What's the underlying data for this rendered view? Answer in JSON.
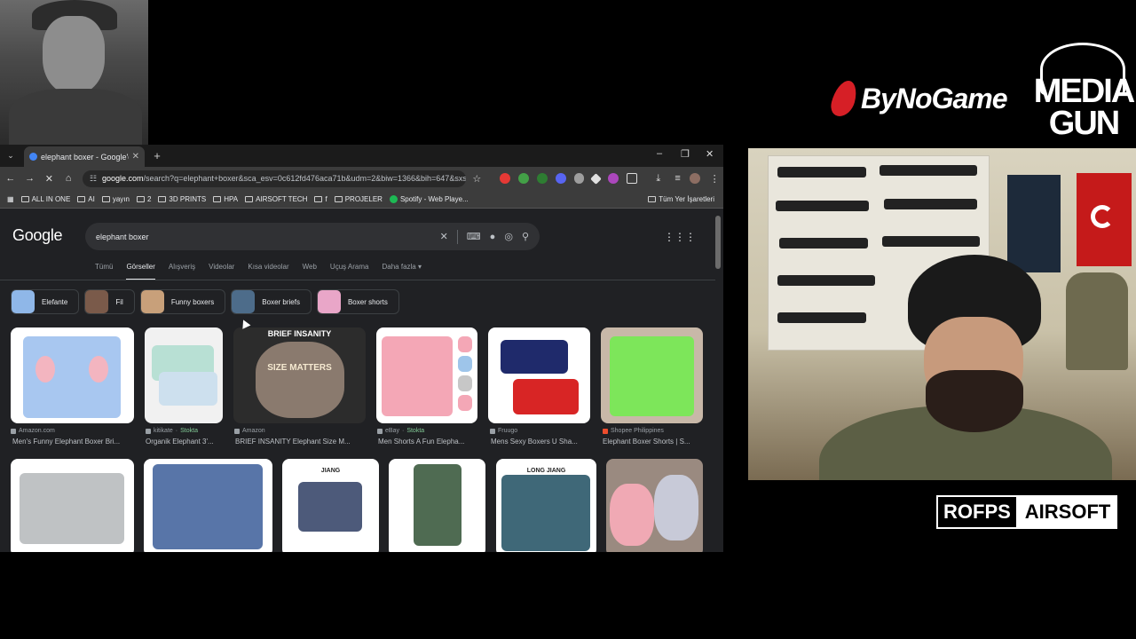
{
  "overlays": {
    "bynogame_label": "ByNoGame",
    "mediagun_line1": "MEDIA",
    "mediagun_line2": "GUN",
    "rofps_left": "ROFPS",
    "rofps_right": "AIRSOFT"
  },
  "browser": {
    "tab_title": "elephant boxer - Google'da Ara",
    "tab_close": "✕",
    "new_tab": "+",
    "url_domain": "google.com",
    "url_path": "/search?q=elephant+boxer&sca_esv=0c612fd476aca71b&udm=2&biw=1366&bih=647&sxsrf...",
    "window_controls": [
      "–",
      "❐",
      "✕"
    ],
    "bookmarks": [
      {
        "label": "ALL IN ONE"
      },
      {
        "label": "AI"
      },
      {
        "label": "yayın"
      },
      {
        "label": "2"
      },
      {
        "label": "3D PRINTS"
      },
      {
        "label": "HPA"
      },
      {
        "label": "AIRSOFT TECH"
      },
      {
        "label": "f"
      },
      {
        "label": "PROJELER"
      },
      {
        "label": "Spotify - Web Playe..."
      }
    ],
    "all_bookmarks": "Tüm Yer İşaretleri"
  },
  "google": {
    "logo": "Google",
    "query": "elephant boxer",
    "tabs": [
      "Tümü",
      "Görseller",
      "Alışveriş",
      "Videolar",
      "Kısa videolar",
      "Web",
      "Uçuş Arama",
      "Daha fazla"
    ],
    "active_tab": "Görseller",
    "chips": [
      "Elefante",
      "Fil",
      "Funny boxers",
      "Boxer briefs",
      "Boxer shorts"
    ],
    "results_row1": [
      {
        "source": "Amazon.com",
        "stock": "",
        "caption": "Men's Funny Elephant Boxer Bri..."
      },
      {
        "source": "kitikate",
        "stock": "Stokta",
        "caption": "Organik Elephant 3'..."
      },
      {
        "source": "Amazon",
        "stock": "",
        "caption": "BRIEF INSANITY Elephant Size M..."
      },
      {
        "source": "eBay",
        "stock": "Stokta",
        "caption": "Men Shorts A Fun Elepha..."
      },
      {
        "source": "Fruugo",
        "stock": "",
        "caption": "Mens Sexy Boxers U Sha..."
      },
      {
        "source": "Shopee Philippines",
        "stock": "",
        "caption": "Elephant Boxer Shorts | S..."
      }
    ],
    "image_texts": {
      "brief_insanity": "BRIEF INSANITY",
      "size_matters": "SIZE MATTERS",
      "long_jiang": "LONG JIANG",
      "jiang": "JIANG"
    }
  },
  "colors": {
    "page_bg": "#202124",
    "accent_red": "#d61f26"
  }
}
